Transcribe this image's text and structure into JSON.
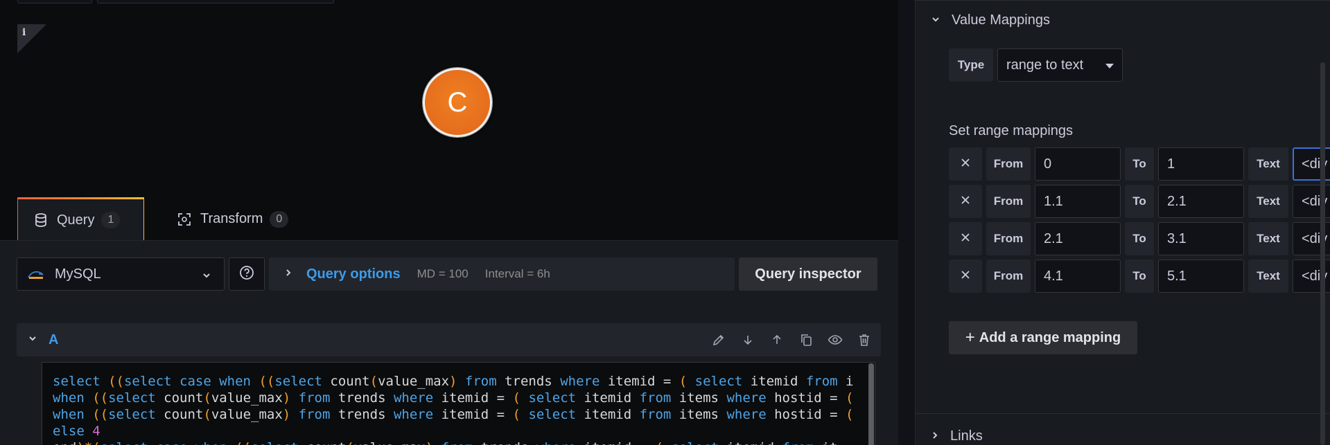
{
  "panel_preview": {
    "info_glyph": "i",
    "avatar_letter": "C"
  },
  "tabs": [
    {
      "label": "Query",
      "count": "1",
      "icon": "database-icon"
    },
    {
      "label": "Transform",
      "count": "0",
      "icon": "transform-icon"
    }
  ],
  "query_bar": {
    "datasource": "MySQL",
    "query_options_label": "Query options",
    "max_data_points": "MD = 100",
    "interval": "Interval = 6h",
    "inspector_label": "Query inspector"
  },
  "query_row": {
    "ref_id": "A"
  },
  "editor": {
    "lines": [
      [
        [
          "kw",
          "select "
        ],
        [
          "pn",
          "(("
        ],
        [
          "kw",
          "select case when "
        ],
        [
          "pn",
          "(("
        ],
        [
          "kw",
          "select "
        ],
        [
          "t",
          "count"
        ],
        [
          "pn",
          "("
        ],
        [
          "t",
          "value_max"
        ],
        [
          "pn",
          ") "
        ],
        [
          "kw",
          "from "
        ],
        [
          "t",
          "trends "
        ],
        [
          "kw",
          "where "
        ],
        [
          "t",
          "itemid = "
        ],
        [
          "pn",
          "( "
        ],
        [
          "kw",
          "select "
        ],
        [
          "t",
          "itemid "
        ],
        [
          "kw",
          "from "
        ],
        [
          "t",
          "i"
        ]
      ],
      [
        [
          "kw",
          "when "
        ],
        [
          "pn",
          "(("
        ],
        [
          "kw",
          "select "
        ],
        [
          "t",
          "count"
        ],
        [
          "pn",
          "("
        ],
        [
          "t",
          "value_max"
        ],
        [
          "pn",
          ") "
        ],
        [
          "kw",
          "from "
        ],
        [
          "t",
          "trends "
        ],
        [
          "kw",
          "where "
        ],
        [
          "t",
          "itemid = "
        ],
        [
          "pn",
          "( "
        ],
        [
          "kw",
          "select "
        ],
        [
          "t",
          "itemid "
        ],
        [
          "kw",
          "from "
        ],
        [
          "t",
          "items "
        ],
        [
          "kw",
          "where "
        ],
        [
          "t",
          "hostid = "
        ],
        [
          "pn",
          "("
        ]
      ],
      [
        [
          "kw",
          "when "
        ],
        [
          "pn",
          "(("
        ],
        [
          "kw",
          "select "
        ],
        [
          "t",
          "count"
        ],
        [
          "pn",
          "("
        ],
        [
          "t",
          "value_max"
        ],
        [
          "pn",
          ") "
        ],
        [
          "kw",
          "from "
        ],
        [
          "t",
          "trends "
        ],
        [
          "kw",
          "where "
        ],
        [
          "t",
          "itemid = "
        ],
        [
          "pn",
          "( "
        ],
        [
          "kw",
          "select "
        ],
        [
          "t",
          "itemid "
        ],
        [
          "kw",
          "from "
        ],
        [
          "t",
          "items "
        ],
        [
          "kw",
          "where "
        ],
        [
          "t",
          "hostid = "
        ],
        [
          "pn",
          "("
        ]
      ],
      [
        [
          "kw",
          "else "
        ],
        [
          "num",
          "4"
        ]
      ],
      [
        [
          "t",
          "end"
        ],
        [
          "pn",
          ")*"
        ],
        [
          "pn",
          "("
        ],
        [
          "kw",
          "select case when "
        ],
        [
          "pn",
          "(("
        ],
        [
          "kw",
          "select "
        ],
        [
          "t",
          "count"
        ],
        [
          "pn",
          "("
        ],
        [
          "t",
          "value_max"
        ],
        [
          "pn",
          ") "
        ],
        [
          "kw",
          "from "
        ],
        [
          "t",
          "trends "
        ],
        [
          "kw",
          "where "
        ],
        [
          "t",
          "itemid = "
        ],
        [
          "pn",
          "( "
        ],
        [
          "kw",
          "select "
        ],
        [
          "t",
          "itemid "
        ],
        [
          "kw",
          "from "
        ],
        [
          "t",
          "it"
        ]
      ]
    ]
  },
  "right_panel": {
    "section_title": "Value Mappings",
    "type_label": "Type",
    "type_value": "range to text",
    "set_range_label": "Set range mappings",
    "from_label": "From",
    "to_label": "To",
    "text_label": "Text",
    "mappings": [
      {
        "from": "0",
        "to": "1",
        "text": "<div st"
      },
      {
        "from": "1.1",
        "to": "2.1",
        "text": "<div ..."
      },
      {
        "from": "2.1",
        "to": "3.1",
        "text": "<div ..."
      },
      {
        "from": "4.1",
        "to": "5.1",
        "text": "<div ..."
      }
    ],
    "add_label": "Add a range mapping",
    "links_title": "Links"
  }
}
